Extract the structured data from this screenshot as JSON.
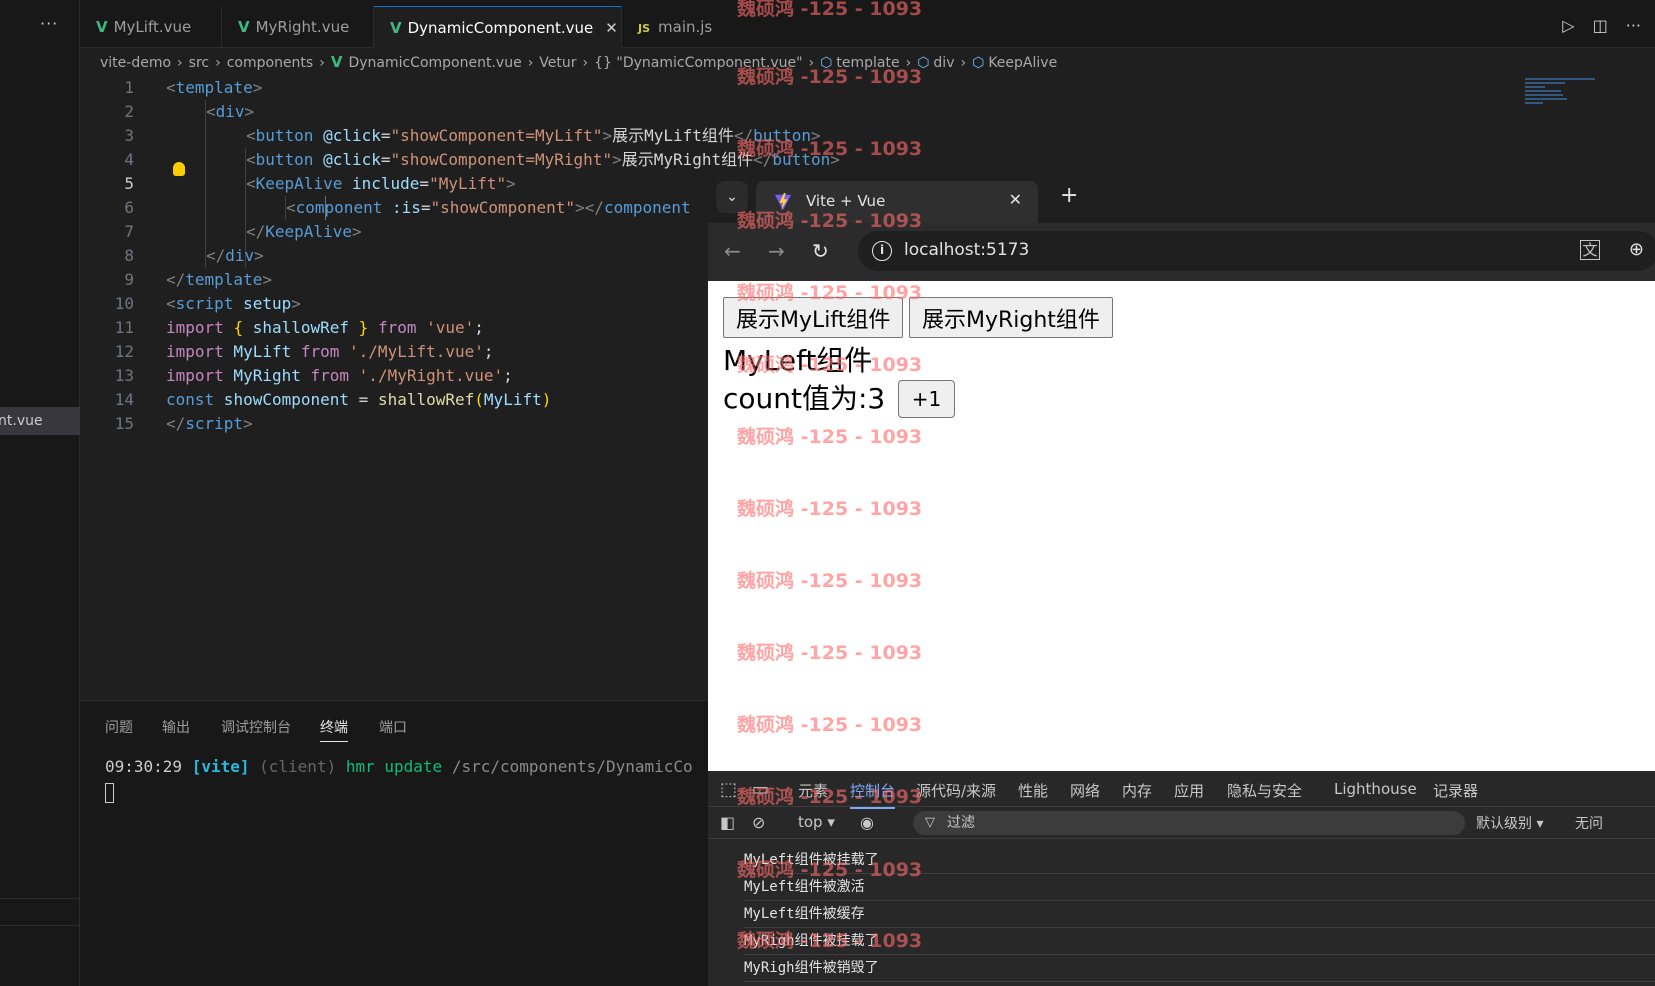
{
  "editor": {
    "tabs": [
      {
        "icon": "V",
        "label": "MyLift.vue"
      },
      {
        "icon": "V",
        "label": "MyRight.vue"
      },
      {
        "icon": "V",
        "label": "DynamicComponent.vue"
      },
      {
        "icon": "JS",
        "label": "main.js"
      }
    ],
    "tab_close": "✕",
    "explorer_item": "nt.vue",
    "breadcrumb": [
      "vite-demo",
      "src",
      "components",
      "DynamicComponent.vue",
      "Vetur",
      "{} \"DynamicComponent.vue\"",
      "template",
      "div",
      "KeepAlive"
    ],
    "lines": [
      {
        "n": "1"
      },
      {
        "n": "2"
      },
      {
        "n": "3"
      },
      {
        "n": "4"
      },
      {
        "n": "5"
      },
      {
        "n": "6"
      },
      {
        "n": "7"
      },
      {
        "n": "8"
      },
      {
        "n": "9"
      },
      {
        "n": "10"
      },
      {
        "n": "11"
      },
      {
        "n": "12"
      },
      {
        "n": "13"
      },
      {
        "n": "14"
      },
      {
        "n": "15"
      }
    ],
    "code": {
      "l1": [
        "<",
        "template",
        ">"
      ],
      "l2": [
        "<",
        "div",
        ">"
      ],
      "l3": [
        "<",
        "button",
        " ",
        "@click",
        "=",
        "\"showComponent=MyLift\"",
        ">",
        "展示MyLift组件",
        "</",
        "button",
        ">"
      ],
      "l4": [
        "<",
        "button",
        " ",
        "@click",
        "=",
        "\"showComponent=MyRight\"",
        ">",
        "展示MyRight组件",
        "</",
        "button",
        ">"
      ],
      "l5": [
        "<",
        "KeepAlive",
        " ",
        "include",
        "=",
        "\"MyLift\"",
        ">"
      ],
      "l6": [
        "<",
        "component",
        " ",
        ":is",
        "=",
        "\"showComponent\"",
        "></",
        "component"
      ],
      "l7": [
        "</",
        "KeepAlive",
        ">"
      ],
      "l8": [
        "</",
        "div",
        ">"
      ],
      "l9": [
        "</",
        "template",
        ">"
      ],
      "l10": [
        "<",
        "script",
        " ",
        "setup",
        ">"
      ],
      "l11": [
        "import",
        " ",
        "{",
        " shallowRef ",
        "}",
        " from ",
        "'vue'",
        ";"
      ],
      "l12": [
        "import",
        " MyLift ",
        "from",
        " ",
        "'./MyLift.vue'",
        ";"
      ],
      "l13": [
        "import",
        " MyRight ",
        "from",
        " ",
        "'./MyRight.vue'",
        ";"
      ],
      "l14": [
        "const",
        " showComponent ",
        "=",
        " ",
        "shallowRef",
        "(",
        "MyLift",
        ")"
      ],
      "l15": [
        "</",
        "script",
        ">"
      ]
    }
  },
  "panel": {
    "tabs": [
      "问题",
      "输出",
      "调试控制台",
      "终端",
      "端口"
    ],
    "active_tab": "终端",
    "terminal": {
      "time": "09:30:29",
      "tag": "[vite]",
      "client": "(client)",
      "msg": "hmr update",
      "path": "/src/components/DynamicCo"
    }
  },
  "browser": {
    "tab_title": "Vite + Vue",
    "tab_close": "✕",
    "new_tab": "+",
    "url": "localhost:5173",
    "page": {
      "button1": "展示MyLift组件",
      "button2": "展示MyRight组件",
      "heading": "MyLeft组件",
      "count_text": "count值为:3",
      "inc_button": "+1"
    },
    "devtools": {
      "tabs": [
        "元素",
        "控制台",
        "源代码/来源",
        "性能",
        "网络",
        "内存",
        "应用",
        "隐私与安全",
        "Lighthouse",
        "记录器"
      ],
      "active_tab": "控制台",
      "context": "top ▾",
      "filter_placeholder": "过滤",
      "level": "默认级别 ▾",
      "issues": "无问",
      "logs": [
        "MyLeft组件被挂载了",
        "MyLeft组件被激活",
        "MyLeft组件被缓存",
        "MyRigh组件被挂载了",
        "MyRigh组件被销毁了"
      ]
    }
  },
  "watermark": "魏硕鸿 -125 - 1093",
  "colors": {
    "accent": "#0078d4",
    "vue_green": "#41b883",
    "devtools_active": "#7cacf8",
    "watermark": "#ff6b6b"
  }
}
